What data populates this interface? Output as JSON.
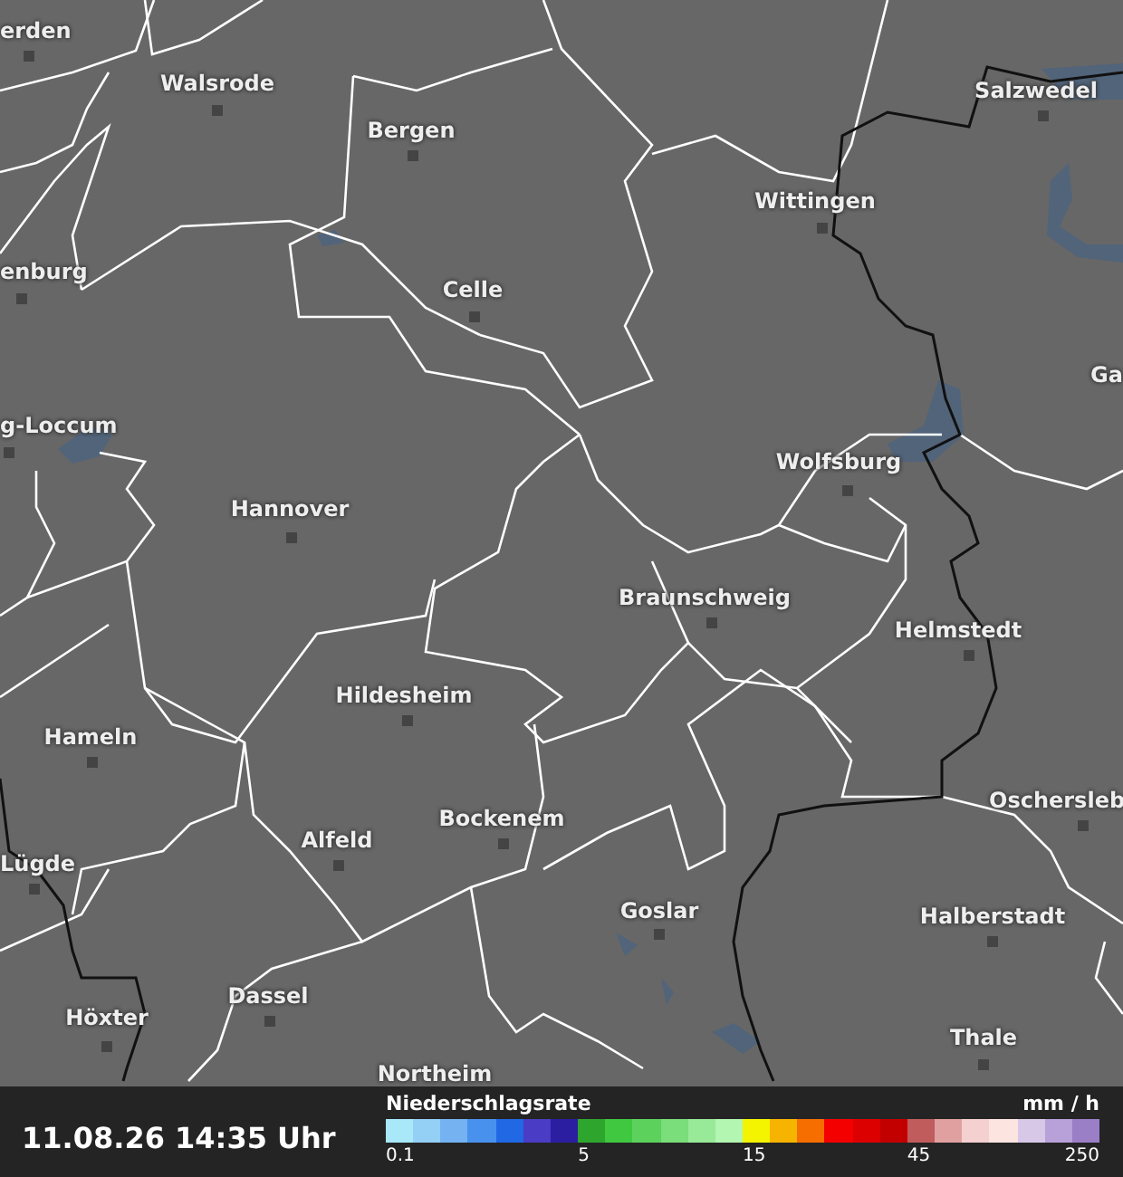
{
  "map": {
    "cities": [
      {
        "name": "erden",
        "marker": true
      },
      {
        "name": "Walsrode",
        "marker": true
      },
      {
        "name": "Bergen",
        "marker": true
      },
      {
        "name": "Salzwedel",
        "marker": true
      },
      {
        "name": "Wittingen",
        "marker": true
      },
      {
        "name": "enburg",
        "marker": true
      },
      {
        "name": "Celle",
        "marker": true
      },
      {
        "name": "Ga",
        "marker": false
      },
      {
        "name": "g-Loccum",
        "marker": true
      },
      {
        "name": "Wolfsburg",
        "marker": true
      },
      {
        "name": "Hannover",
        "marker": true
      },
      {
        "name": "Braunschweig",
        "marker": true
      },
      {
        "name": "Helmstedt",
        "marker": true
      },
      {
        "name": "Hildesheim",
        "marker": true
      },
      {
        "name": "Hameln",
        "marker": true
      },
      {
        "name": "Oschersleb",
        "marker": true
      },
      {
        "name": "Bockenem",
        "marker": true
      },
      {
        "name": "Alfeld",
        "marker": true
      },
      {
        "name": "Lügde",
        "marker": true
      },
      {
        "name": "Goslar",
        "marker": true
      },
      {
        "name": "Halberstadt",
        "marker": true
      },
      {
        "name": "Dassel",
        "marker": true
      },
      {
        "name": "Höxter",
        "marker": true
      },
      {
        "name": "Thale",
        "marker": true
      },
      {
        "name": "Northeim",
        "marker": false
      }
    ]
  },
  "footer": {
    "timestamp": "11.08.26 14:35 Uhr",
    "legend": {
      "title": "Niederschlagsrate",
      "unit": "mm / h",
      "end_label": "250",
      "segments": [
        {
          "color": "#a8e8f8",
          "label": "0.1"
        },
        {
          "color": "#94d0f6"
        },
        {
          "color": "#74b2f2"
        },
        {
          "color": "#4892ee"
        },
        {
          "color": "#2068e4"
        },
        {
          "color": "#4a3cc4"
        },
        {
          "color": "#2c1ea0"
        },
        {
          "color": "#2ea62e",
          "label": "5"
        },
        {
          "color": "#40c840"
        },
        {
          "color": "#5cd25c"
        },
        {
          "color": "#7ade7a"
        },
        {
          "color": "#98ea98"
        },
        {
          "color": "#b2f6b2"
        },
        {
          "color": "#f4f400",
          "label": "15"
        },
        {
          "color": "#f6b400"
        },
        {
          "color": "#f66e00"
        },
        {
          "color": "#f40000"
        },
        {
          "color": "#dc0000"
        },
        {
          "color": "#c20000"
        },
        {
          "color": "#c05c5c",
          "label": "45"
        },
        {
          "color": "#e0a0a0"
        },
        {
          "color": "#f4d0d0"
        },
        {
          "color": "#fce4e0"
        },
        {
          "color": "#d8c8e8"
        },
        {
          "color": "#b8a0d8"
        },
        {
          "color": "#9a7ec6"
        }
      ]
    }
  }
}
